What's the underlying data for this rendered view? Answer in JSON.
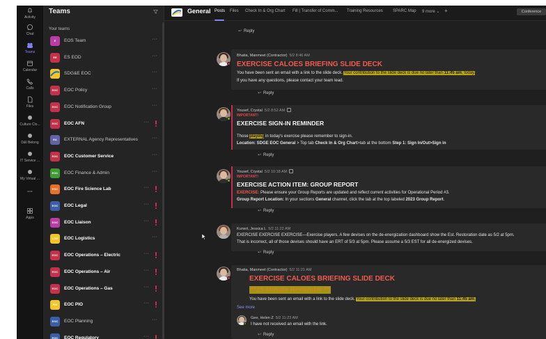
{
  "rail": {
    "items": [
      {
        "label": "Activity",
        "icon": "bell-icon"
      },
      {
        "label": "Chat",
        "icon": "chat-icon"
      },
      {
        "label": "Teams",
        "icon": "teams-icon"
      },
      {
        "label": "Calendar",
        "icon": "calendar-icon"
      },
      {
        "label": "Calls",
        "icon": "phone-icon"
      },
      {
        "label": "Files",
        "icon": "file-icon"
      },
      {
        "label": "Culture Clo...",
        "icon": "app-icon"
      },
      {
        "label": "D&I Belong",
        "icon": "app-icon"
      },
      {
        "label": "IT Service ...",
        "icon": "app-icon"
      },
      {
        "label": "My Virtual ...",
        "icon": "app-icon"
      },
      {
        "label": "...",
        "icon": "more-icon"
      },
      {
        "label": "Apps",
        "icon": "apps-icon"
      }
    ]
  },
  "teams_pane": {
    "title": "Teams",
    "section_label": "Your teams",
    "teams": [
      {
        "name": "EOS Team",
        "abbr": "E",
        "color": "#b83ea3",
        "bold": false,
        "alert": false
      },
      {
        "name": "ES EOD",
        "abbr": "EE",
        "color": "#c4314b",
        "bold": false,
        "alert": false
      },
      {
        "name": "SDG&E EOC",
        "abbr": "",
        "color": "#f3c52a",
        "bold": false,
        "alert": false
      },
      {
        "name": "EOC Policy",
        "abbr": "EOC Policy",
        "color": "#c4314b",
        "bold": false,
        "alert": false
      },
      {
        "name": "EOC Notification Group",
        "abbr": "EOC NOTIF",
        "color": "#c4314b",
        "bold": false,
        "alert": false
      },
      {
        "name": "EOC AFN",
        "abbr": "EOC AFN",
        "color": "#c4314b",
        "bold": true,
        "alert": true
      },
      {
        "name": "EXTERNAL Agency Representatives",
        "abbr": "EA",
        "color": "#6264a7",
        "bold": false,
        "alert": false
      },
      {
        "name": "EOC Customer Service",
        "abbr": "EOC CS",
        "color": "#c4314b",
        "bold": true,
        "alert": false
      },
      {
        "name": "EOC Finance & Admin",
        "abbr": "EOC FIN",
        "color": "#3f9c35",
        "bold": false,
        "alert": false
      },
      {
        "name": "EOC Fire Science Lab",
        "abbr": "EOC FSL",
        "color": "#e8702a",
        "bold": true,
        "alert": true
      },
      {
        "name": "EOC Legal",
        "abbr": "EOC LEGAL",
        "color": "#3a5fa8",
        "bold": true,
        "alert": true
      },
      {
        "name": "EOC Liaison",
        "abbr": "EOC Liaison",
        "color": "#b83ea3",
        "bold": true,
        "alert": true
      },
      {
        "name": "EOC Logistics",
        "abbr": "LOG",
        "color": "#f3c52a",
        "bold": true,
        "alert": false
      },
      {
        "name": "EOC Operations – Electric",
        "abbr": "EOC OPS E",
        "color": "#c4314b",
        "bold": true,
        "alert": true
      },
      {
        "name": "EOC Operations – Air",
        "abbr": "EOC OPS A",
        "color": "#c4314b",
        "bold": true,
        "alert": true
      },
      {
        "name": "EOC Operations – Gas",
        "abbr": "EOC OPS G",
        "color": "#c4314b",
        "bold": true,
        "alert": true
      },
      {
        "name": "EOC PIO",
        "abbr": "PIO",
        "color": "#f3c52a",
        "bold": true,
        "alert": true
      },
      {
        "name": "EOC Planning",
        "abbr": "EOC PLAN",
        "color": "#3a5fa8",
        "bold": false,
        "alert": false
      },
      {
        "name": "EOC Regulatory",
        "abbr": "EOC",
        "color": "#3a5fa8",
        "bold": true,
        "alert": true
      }
    ],
    "more_label": "···"
  },
  "channel": {
    "name": "General",
    "tabs": [
      "Posts",
      "Files",
      "Check In & Org Chart",
      "Fill | Transfer of Comm...",
      "Training Resources",
      "SPARC Map",
      "9 more"
    ],
    "add_tab": "+",
    "right_button": "Conference"
  },
  "messages": [
    {
      "reply_only": true,
      "reply_label": "Reply"
    },
    {
      "author": "Bhatia, Manmeet (Contractor)",
      "time": "5/2 8:46 AM",
      "title": "EXERCISE CALOES BRIEFING SLIDE DECK",
      "line1_a": "You have been sent an email with a link to the slide deck. ",
      "line1_hl": "Your contribution to the slide deck is due no later than ",
      "line1_hlb": "11:45 am",
      "line1_hl2": ", today.",
      "line2": "If you have any questions, please contact your team lead.",
      "reply_label": "Reply"
    },
    {
      "author": "Yousef, Crystal",
      "time": "5/2 8:52 AM",
      "important": "IMPORTANT!",
      "title": "EXERCISE SIGN-IN REMINDER",
      "line1_a": "Those ",
      "line1_hl": "playing",
      "line1_b": " in today's exercise please remember to sign-in.",
      "line2_b1": "Location: SDGE EOC General",
      "line2_t1": " > Top tab ",
      "line2_b2": "Check In & Org Chart",
      "line2_t2": ">tab at the bottom ",
      "line2_b3": "Step 1: Sign In/Out>Sign in",
      "reply_label": "Reply"
    },
    {
      "author": "Yousef, Crystal",
      "time": "5/2 10:18 AM",
      "important": "IMPORTANT!",
      "title": "EXERCISE ACTION ITEM: GROUP REPORT",
      "line1_red": "EXERCISE:",
      "line1_t": " Please ensure your Group Reports are updated and reflect current activities for Operational Period #3.",
      "line2_b1": "Group Report Location:",
      "line2_t1": " In your sections ",
      "line2_b2": "General",
      "line2_t2": " channel, click the tab at the top labeled ",
      "line2_b3": "2023 Group Report",
      "line2_t3": ".",
      "reply_label": "Reply"
    },
    {
      "author": "Kunert, Jessica L",
      "time": "5/2 11:22 AM",
      "line1": "EXERCISE EXERCISE EXERCISE—Exercise players. A few devises on the de-energization dashboard show the Est. Restoration date as 5/2 at 5pm.",
      "line2": "That is incorrect, all of those devises should have an ERT of 5/3 at 5pm. Please assume a 5/3 EST for all de-energized devises.",
      "reply_label": "Reply"
    },
    {
      "author": "Bhatia, Manmeet (Contractor)",
      "time": "5/2 11:21 AM",
      "title": "EXERCISE CALOES BRIEFING SLIDE DECK",
      "banner": "**25 Minute Reminder **",
      "line1_a": "You have been sent an email with a link to the slide deck. ",
      "line1_hl": "Your contribution to the slide deck is due no later than ",
      "line1_hlb": "11:45 am",
      "line1_hl2": ",",
      "see_more": "See more",
      "sub_author": "Gee, Helen Z",
      "sub_time": "5/2 11:23 AM",
      "sub_text": "I have not received an email with the link.",
      "reply_label": "Reply"
    }
  ],
  "colors": {
    "accent": "#7f85f5",
    "alert": "#c4314b",
    "highlight": "#b9a412",
    "title_red": "#f05a4f"
  }
}
